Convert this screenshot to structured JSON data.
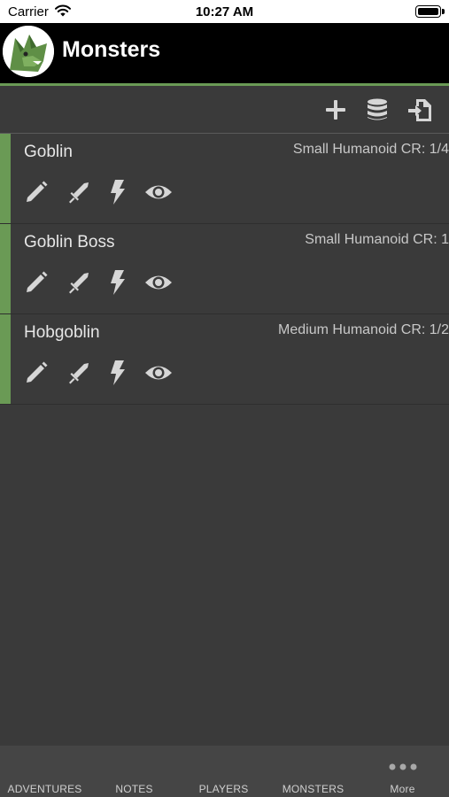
{
  "status_bar": {
    "carrier": "Carrier",
    "time": "10:27 AM"
  },
  "nav": {
    "title": "Monsters"
  },
  "toolbar": {
    "icons": [
      "plus-icon",
      "database-icon",
      "import-icon"
    ]
  },
  "colors": {
    "accent": "#6a9a55",
    "background": "#3a3a3a",
    "navbar": "#000000",
    "tabbar": "#454545"
  },
  "monsters": [
    {
      "name": "Goblin",
      "meta": "Small Humanoid CR: 1/4"
    },
    {
      "name": "Goblin Boss",
      "meta": "Small Humanoid CR: 1"
    },
    {
      "name": "Hobgoblin",
      "meta": "Medium Humanoid CR: 1/2"
    }
  ],
  "row_actions": [
    "pencil-icon",
    "sword-icon",
    "lightning-icon",
    "eye-icon"
  ],
  "tabs": [
    {
      "label": "ADVENTURES"
    },
    {
      "label": "NOTES"
    },
    {
      "label": "PLAYERS"
    },
    {
      "label": "MONSTERS"
    },
    {
      "label": "More"
    }
  ]
}
